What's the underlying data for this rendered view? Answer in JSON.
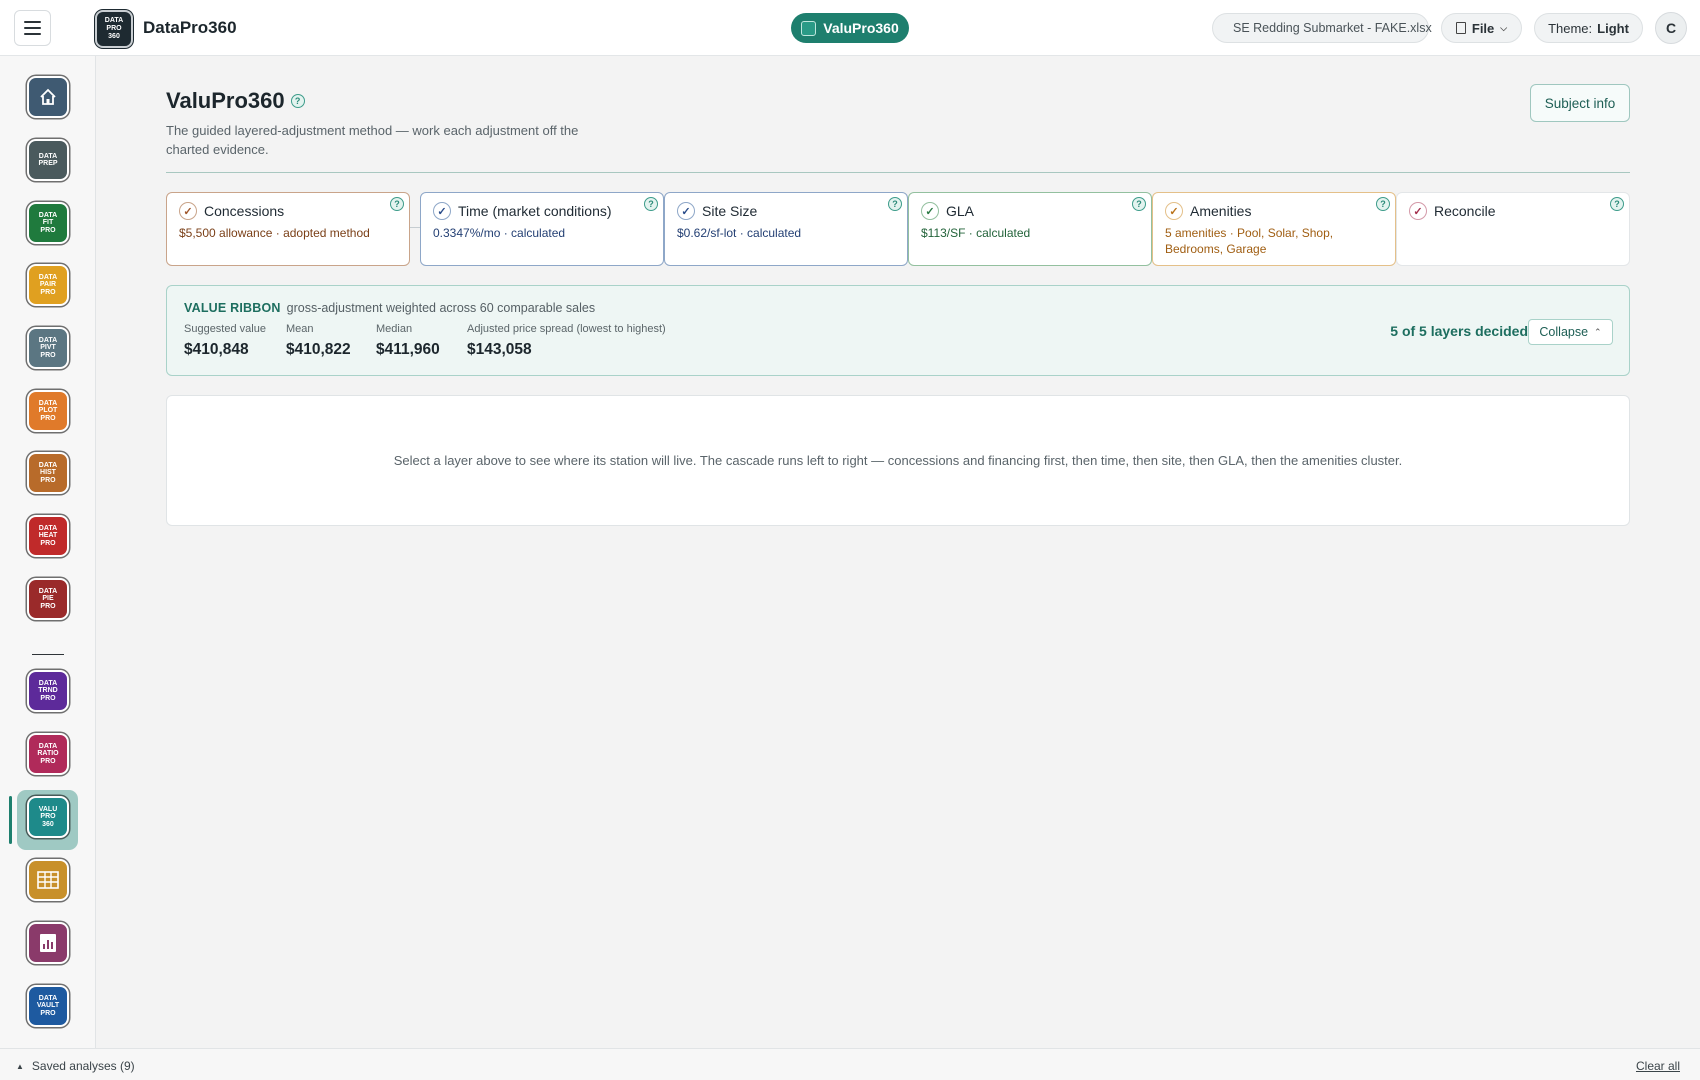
{
  "topbar": {
    "brand_logo_text": [
      "DATA",
      "PRO",
      "360"
    ],
    "brand_name": "DataPro360",
    "active_app": "ValuPro360",
    "file_name": "SE Redding Submarket - FAKE.xlsx",
    "file_menu": "File",
    "theme_label": "Theme:",
    "theme_value": "Light",
    "avatar_initial": "C"
  },
  "sidebar": {
    "apps": [
      {
        "name": "home",
        "lines": [],
        "color": "#3f5a72"
      },
      {
        "name": "data-prep",
        "lines": [
          "DATA",
          "PREP"
        ],
        "color": "#4a5a5d"
      },
      {
        "name": "data-fit-pro",
        "lines": [
          "DATA",
          "FIT",
          "PRO"
        ],
        "color": "#1f7a3d"
      },
      {
        "name": "data-pair-pro",
        "lines": [
          "DATA",
          "PAIR",
          "PRO"
        ],
        "color": "#e0a020"
      },
      {
        "name": "data-pivt-pro",
        "lines": [
          "DATA",
          "PIVT",
          "PRO"
        ],
        "color": "#5b7682"
      },
      {
        "name": "data-plot-pro",
        "lines": [
          "DATA",
          "PLOT",
          "PRO"
        ],
        "color": "#e07a2a"
      },
      {
        "name": "data-hist-pro",
        "lines": [
          "DATA",
          "HIST",
          "PRO"
        ],
        "color": "#b86b2a"
      },
      {
        "name": "data-heat-pro",
        "lines": [
          "DATA",
          "HEAT",
          "PRO"
        ],
        "color": "#c02a2a"
      },
      {
        "name": "data-pie-pro",
        "lines": [
          "DATA",
          "PIE",
          "PRO"
        ],
        "color": "#9a2a2a"
      },
      {
        "name": "data-trnd-pro",
        "lines": [
          "DATA",
          "TRND",
          "PRO"
        ],
        "color": "#5d2a9a"
      },
      {
        "name": "data-ratio-pro",
        "lines": [
          "DATA",
          "RATIO",
          "PRO"
        ],
        "color": "#b02a5a"
      },
      {
        "name": "valu-pro-360",
        "lines": [
          "VALU",
          "PRO",
          "360"
        ],
        "color": "#1e8a8a"
      },
      {
        "name": "table-tool",
        "lines": [],
        "color": "#c8902a"
      },
      {
        "name": "report-tool",
        "lines": [],
        "color": "#8a3a6a"
      },
      {
        "name": "data-vault-pro",
        "lines": [
          "DATA",
          "VAULT",
          "PRO"
        ],
        "color": "#1e5aa0"
      }
    ]
  },
  "main": {
    "title": "ValuPro360",
    "help": "?",
    "subtitle": "The guided layered-adjustment method — work each adjustment off the charted evidence.",
    "subject_info": "Subject info",
    "layers": [
      {
        "title": "Concessions",
        "detail": "$5,500 allowance · adopted method"
      },
      {
        "title": "Time (market conditions)",
        "detail": "0.3347%/mo · calculated"
      },
      {
        "title": "Site Size",
        "detail": "$0.62/sf-lot · calculated"
      },
      {
        "title": "GLA",
        "detail": "$113/SF · calculated"
      },
      {
        "title": "Amenities",
        "detail": "5 amenities · Pool, Solar, Shop, Bedrooms, Garage"
      },
      {
        "title": "Reconcile",
        "detail": ""
      }
    ],
    "check_glyph": "✓",
    "ribbon": {
      "label": "VALUE RIBBON",
      "description": "gross-adjustment weighted across 60 comparable sales",
      "stats": [
        {
          "label": "Suggested value",
          "value": "$410,848"
        },
        {
          "label": "Mean",
          "value": "$410,822"
        },
        {
          "label": "Median",
          "value": "$411,960"
        },
        {
          "label": "Adjusted price spread (lowest to highest)",
          "value": "$143,058"
        }
      ],
      "layers_decided": "5 of 5 layers decided",
      "collapse": "Collapse"
    },
    "info_text": "Select a layer above to see where its station will live. The cascade runs left to right — concessions and financing first, then time, then site, then GLA, then the amenities cluster."
  },
  "footer": {
    "saved_analyses": "Saved analyses (9)",
    "clear_all": "Clear all"
  }
}
